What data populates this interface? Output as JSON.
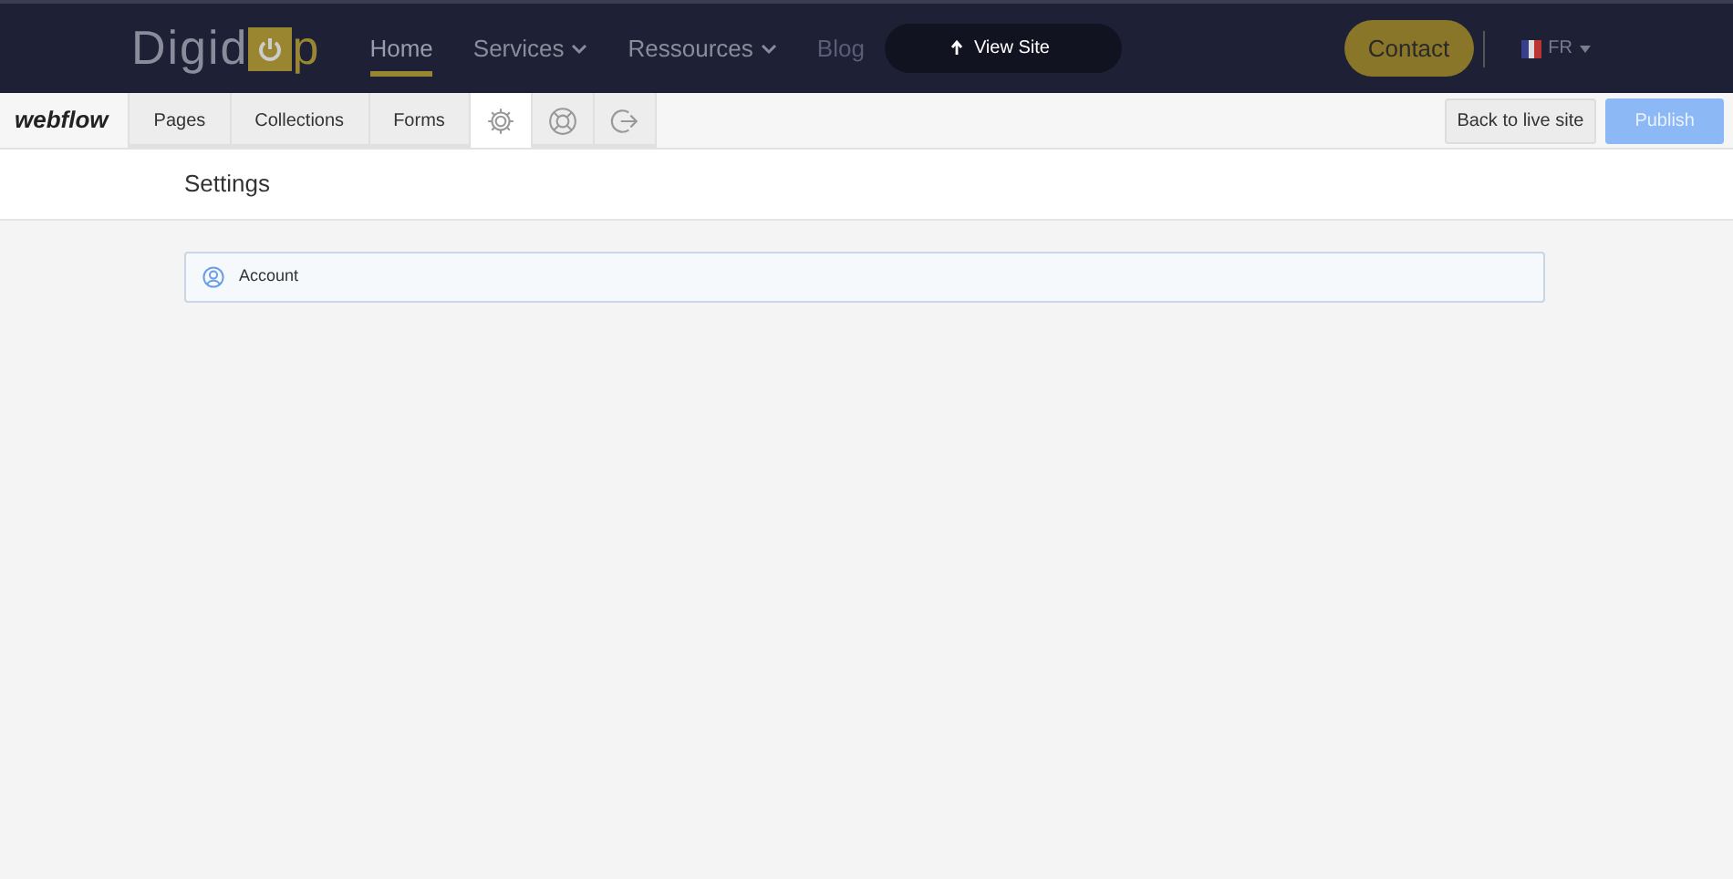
{
  "site_nav": {
    "logo": {
      "before": "Digid",
      "after": "p"
    },
    "links": [
      {
        "label": "Home",
        "selected": true,
        "dropdown": false
      },
      {
        "label": "Services",
        "selected": false,
        "dropdown": true
      },
      {
        "label": "Ressources",
        "selected": false,
        "dropdown": true
      },
      {
        "label": "Blog",
        "selected": false,
        "dropdown": false
      }
    ],
    "view_site": "View Site",
    "contact": "Contact",
    "language": "FR"
  },
  "editor_bar": {
    "brand": "webflow",
    "tabs": [
      {
        "kind": "text",
        "label": "Pages",
        "selected": false
      },
      {
        "kind": "text",
        "label": "Collections",
        "selected": false
      },
      {
        "kind": "text",
        "label": "Forms",
        "selected": false
      },
      {
        "kind": "gear",
        "selected": true
      },
      {
        "kind": "help",
        "selected": false
      },
      {
        "kind": "logout",
        "selected": false
      }
    ],
    "back_button": "Back to live site",
    "publish_button": "Publish",
    "publish_disabled": true
  },
  "page": {
    "title": "Settings",
    "items": [
      {
        "label": "Account"
      }
    ]
  }
}
